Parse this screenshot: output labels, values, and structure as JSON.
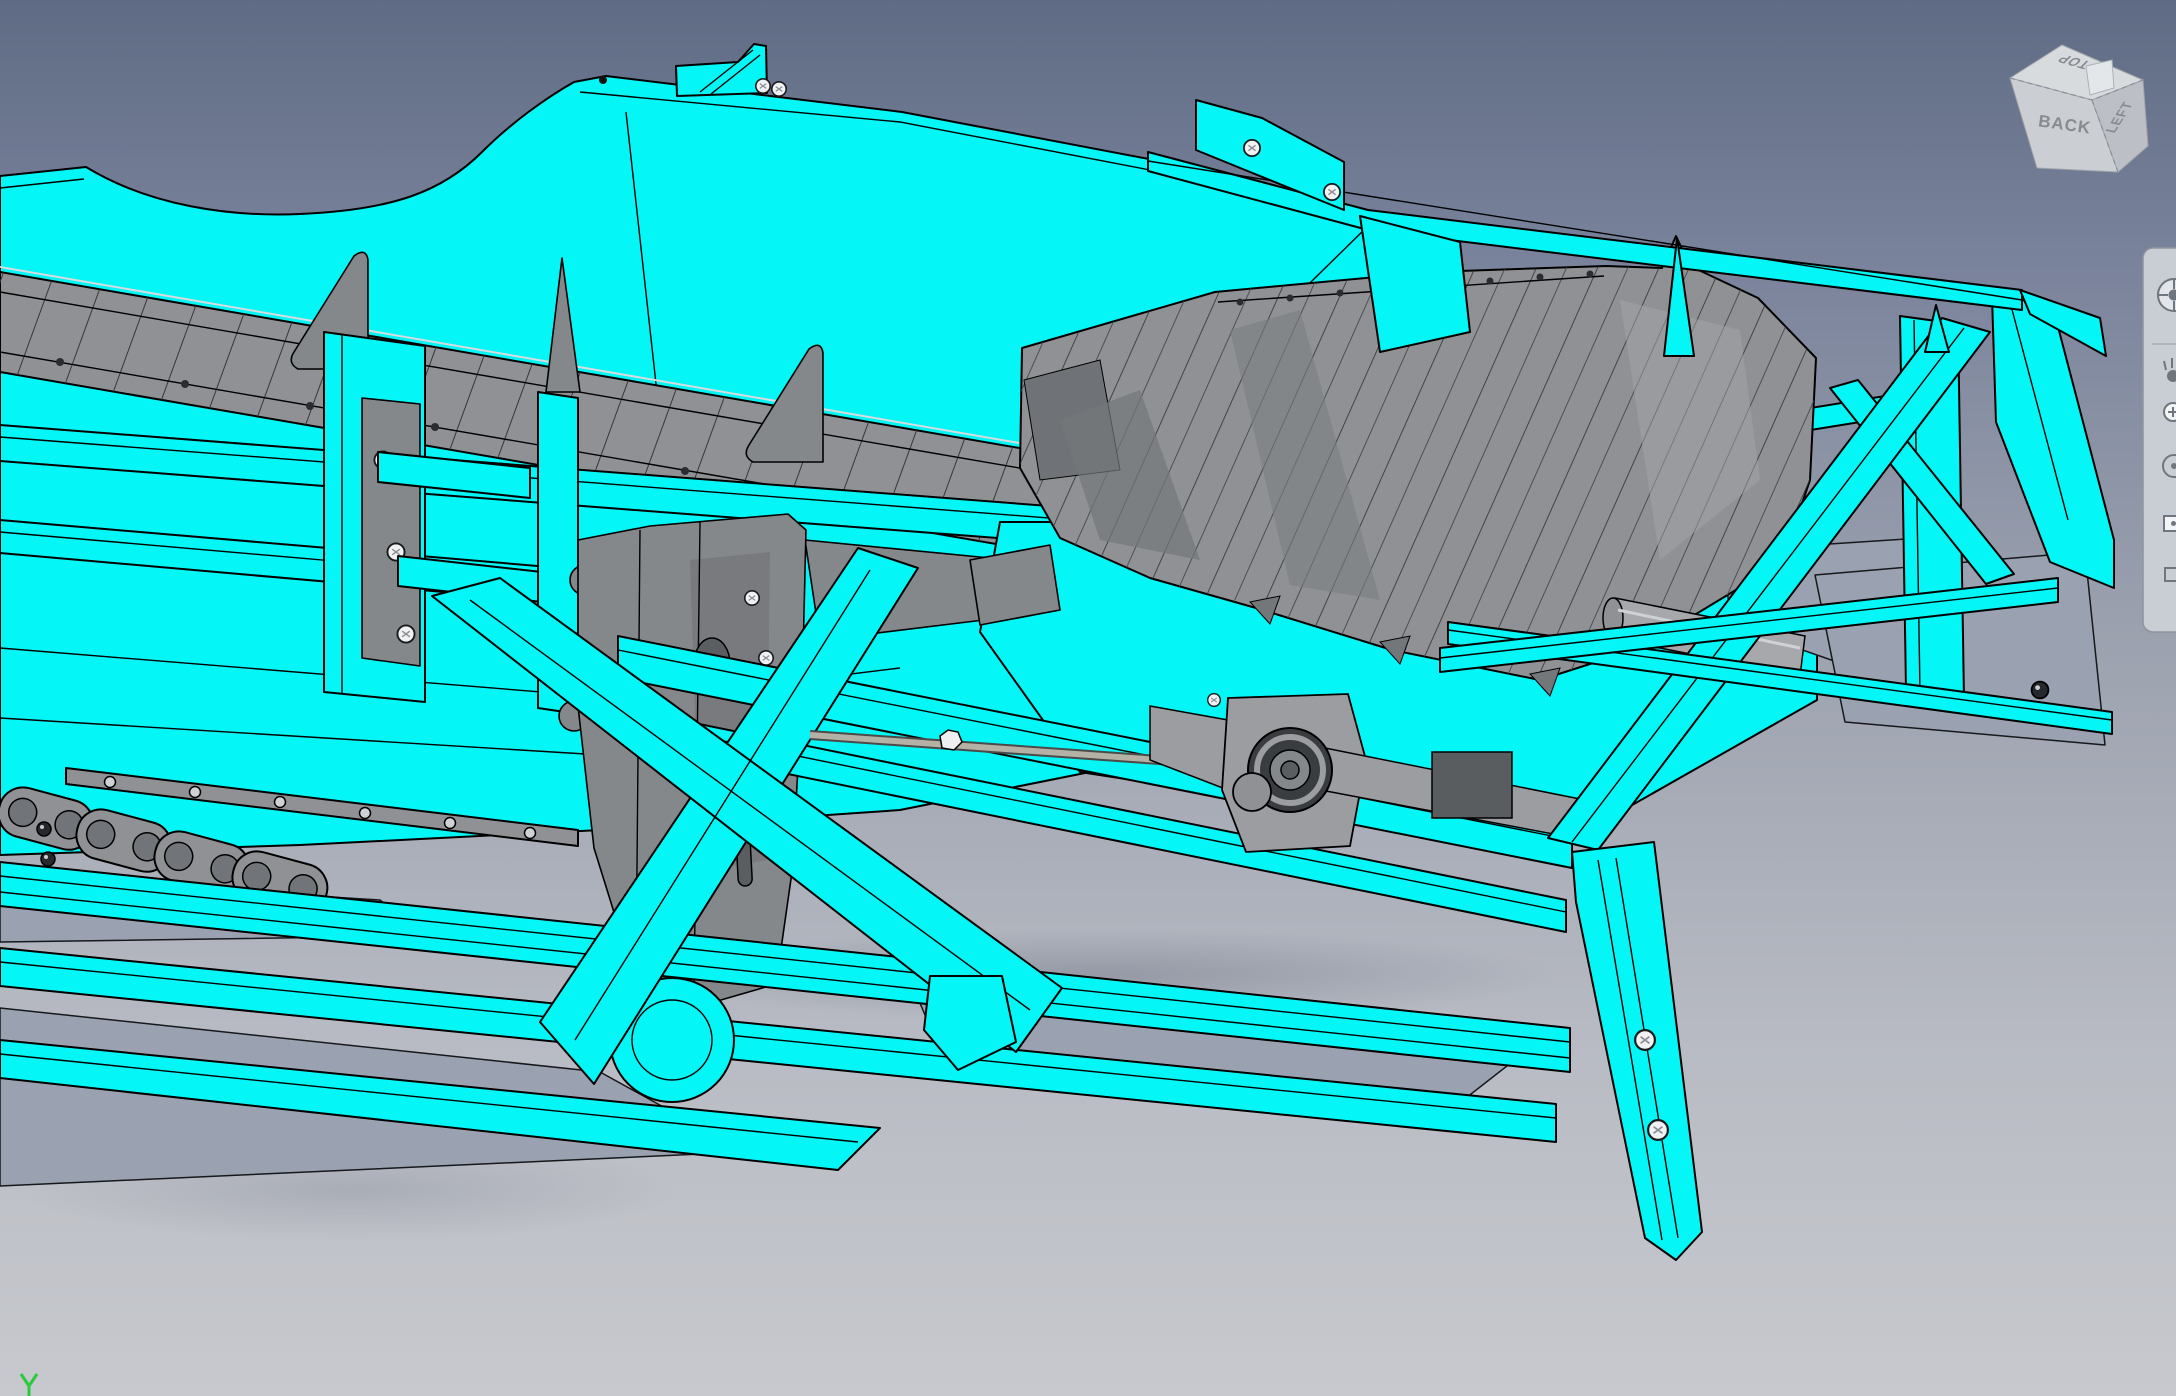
{
  "viewport": {
    "background": {
      "top": "#5F6B84",
      "upper": "#79829B",
      "middle": "#9BA1AE",
      "lower": "#B8BBC3",
      "bottom": "#C7C9CE"
    },
    "selection_highlight_color": "#04F6F6",
    "part_gray_color": "#8F9194",
    "edge_color": "#000000"
  },
  "view_cube": {
    "faces": [
      {
        "id": "top",
        "label": "TOP"
      },
      {
        "id": "back",
        "label": "BACK"
      },
      {
        "id": "left",
        "label": "LEFT"
      }
    ]
  },
  "navigation_bar": {
    "icons": [
      {
        "name": "full-navigation-wheel"
      },
      {
        "name": "pan"
      },
      {
        "name": "zoom"
      },
      {
        "name": "orbit"
      },
      {
        "name": "look-at"
      }
    ]
  },
  "origin_indicator": {
    "axis_label": "Y",
    "color": "#2BC93E"
  }
}
